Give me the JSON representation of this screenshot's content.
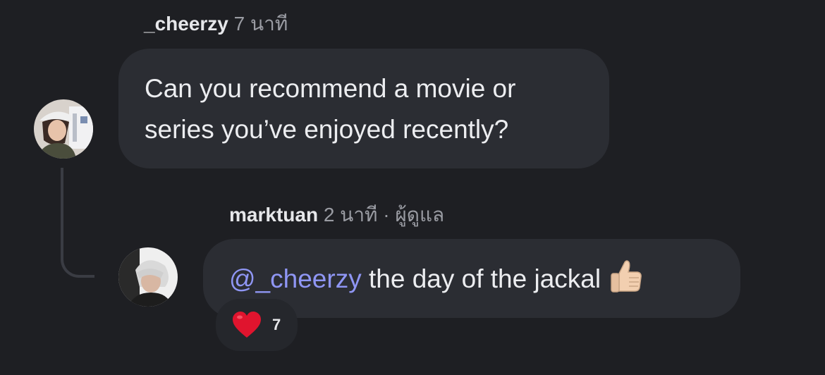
{
  "comment": {
    "username": "_cheerzy",
    "time": "7 นาที",
    "text_line1": "Can you recommend a movie or",
    "text_line2": "series you’ve enjoyed recently?"
  },
  "reply": {
    "username": "marktuan",
    "time": "2 นาที",
    "separator": "·",
    "role": "ผู้ดูแล",
    "mention": "@_cheerzy",
    "text": " the day of the jackal ",
    "emoji": "thumbs-up-icon",
    "reaction": {
      "icon": "heart-icon",
      "count": "7"
    }
  },
  "colors": {
    "background": "#1e1f23",
    "bubble": "#2b2d33",
    "mention": "#8f96f4",
    "muted": "#9a9ca3",
    "heart": "#e0142e"
  }
}
